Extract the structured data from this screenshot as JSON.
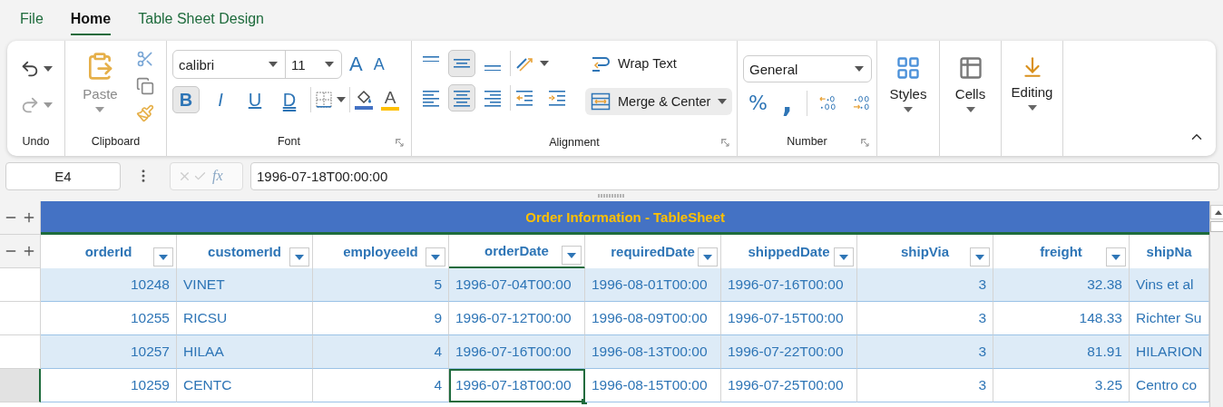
{
  "menu_tabs": [
    {
      "label": "File",
      "selected": false
    },
    {
      "label": "Home",
      "selected": true
    },
    {
      "label": "Table Sheet Design",
      "selected": false
    }
  ],
  "ribbon": {
    "undo": {
      "label": "Undo"
    },
    "clipboard": {
      "label": "Clipboard",
      "paste": "Paste"
    },
    "font": {
      "label": "Font",
      "family": "calibri",
      "size": "11",
      "grow": "A",
      "shrink": "A",
      "font_color_glyph": "A",
      "styles": [
        {
          "kind": "bold",
          "glyph": "B",
          "selected": true
        },
        {
          "kind": "italic",
          "glyph": "I",
          "selected": false
        },
        {
          "kind": "underline",
          "glyph": "U",
          "selected": false
        },
        {
          "kind": "double-underline",
          "glyph": "D",
          "selected": false
        }
      ]
    },
    "alignment": {
      "label": "Alignment",
      "vertical": [
        {
          "kind": "top",
          "selected": false
        },
        {
          "kind": "middle",
          "selected": true
        },
        {
          "kind": "bottom",
          "selected": false
        }
      ],
      "horizontal": [
        {
          "kind": "left",
          "selected": false
        },
        {
          "kind": "center",
          "selected": true
        },
        {
          "kind": "right",
          "selected": false
        }
      ],
      "wrap_text": "Wrap Text",
      "merge": "Merge & Center"
    },
    "number": {
      "label": "Number",
      "format": "General",
      "percent": "%",
      "comma": ","
    },
    "big_buttons": [
      {
        "kind": "styles",
        "label": "Styles"
      },
      {
        "kind": "cells",
        "label": "Cells"
      },
      {
        "kind": "editing",
        "label": "Editing"
      }
    ]
  },
  "formula_bar": {
    "cell_ref": "E4",
    "fx": "fx",
    "value": "1996-07-18T00:00:00"
  },
  "sheet": {
    "title": "Order Information - TableSheet",
    "columns": [
      {
        "label": "orderId",
        "kind": "number",
        "selected": false
      },
      {
        "label": "customerId",
        "kind": "text",
        "selected": false
      },
      {
        "label": "employeeId",
        "kind": "number",
        "selected": false
      },
      {
        "label": "orderDate",
        "kind": "text",
        "selected": true
      },
      {
        "label": "requiredDate",
        "kind": "text",
        "selected": false
      },
      {
        "label": "shippedDate",
        "kind": "text",
        "selected": false
      },
      {
        "label": "shipVia",
        "kind": "number",
        "selected": false
      },
      {
        "label": "freight",
        "kind": "number",
        "selected": false
      },
      {
        "label": "shipNa",
        "kind": "text",
        "selected": false
      }
    ],
    "rows": [
      {
        "selected": false,
        "cells": [
          "10248",
          "VINET",
          "5",
          "1996-07-04T00:00",
          "1996-08-01T00:00",
          "1996-07-16T00:00",
          "3",
          "32.38",
          "Vins et al"
        ]
      },
      {
        "selected": false,
        "cells": [
          "10255",
          "RICSU",
          "9",
          "1996-07-12T00:00",
          "1996-08-09T00:00",
          "1996-07-15T00:00",
          "3",
          "148.33",
          "Richter Su"
        ]
      },
      {
        "selected": false,
        "cells": [
          "10257",
          "HILAA",
          "4",
          "1996-07-16T00:00",
          "1996-08-13T00:00",
          "1996-07-22T00:00",
          "3",
          "81.91",
          "HILARION"
        ]
      },
      {
        "selected": true,
        "cells": [
          "10259",
          "CENTC",
          "4",
          "1996-07-18T00:00",
          "1996-08-15T00:00",
          "1996-07-25T00:00",
          "3",
          "3.25",
          "Centro co"
        ]
      }
    ]
  }
}
